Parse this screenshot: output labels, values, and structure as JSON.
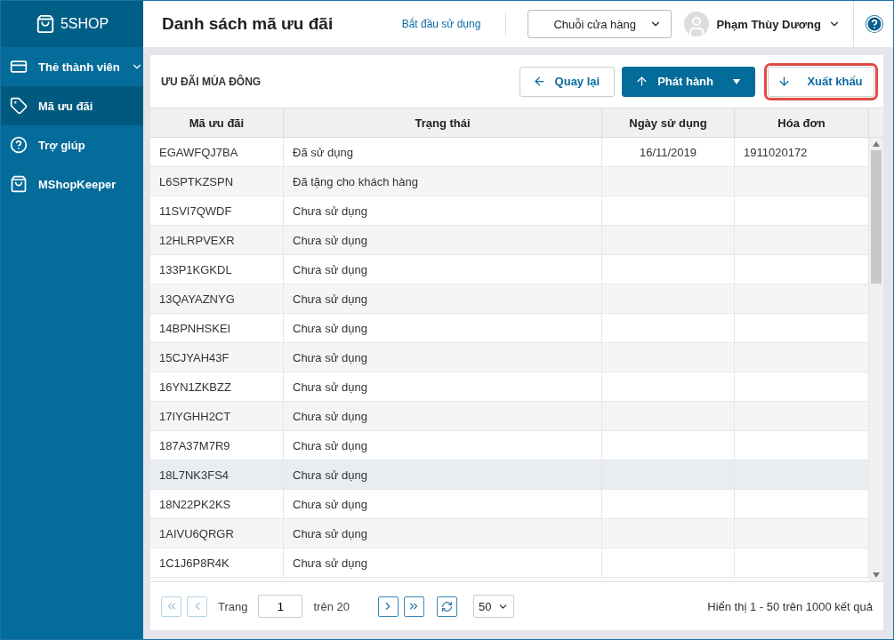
{
  "brand": "5SHOP",
  "sidebar": {
    "items": [
      {
        "label": "Thẻ thành viên",
        "has_caret": true,
        "selected": false
      },
      {
        "label": "Mã ưu đãi",
        "has_caret": false,
        "selected": true
      },
      {
        "label": "Trợ giúp",
        "has_caret": false,
        "selected": false
      },
      {
        "label": "MShopKeeper",
        "has_caret": false,
        "selected": false
      }
    ]
  },
  "header": {
    "title": "Danh sách mã ưu đãi",
    "start_link": "Bắt đầu sử dụng",
    "store_select": "Chuỗi cửa hàng",
    "user_name": "Phạm Thùy Dương"
  },
  "panel": {
    "title": "ƯU ĐÃI MÙA ĐÔNG",
    "buttons": [
      {
        "label": "Quay lại",
        "kind": "back",
        "highlighted": false
      },
      {
        "label": "Phát hành",
        "kind": "issue",
        "highlighted": false
      },
      {
        "label": "Xuất khẩu",
        "kind": "export",
        "highlighted": true
      }
    ]
  },
  "table": {
    "columns": [
      "Mã ưu đãi",
      "Trạng thái",
      "Ngày sử dụng",
      "Hóa đơn"
    ],
    "rows": [
      {
        "code": "EGAWFQJ7BA",
        "status": "Đã sử dụng",
        "date": "16/11/2019",
        "invoice": "1911020172",
        "selected": false
      },
      {
        "code": "L6SPTKZSPN",
        "status": "Đã tặng cho khách hàng",
        "selected": false
      },
      {
        "code": "11SVI7QWDF",
        "status": "Chưa sử dụng",
        "selected": false
      },
      {
        "code": "12HLRPVEXR",
        "status": "Chưa sử dụng",
        "selected": false
      },
      {
        "code": "133P1KGKDL",
        "status": "Chưa sử dụng",
        "selected": false
      },
      {
        "code": "13QAYAZNYG",
        "status": "Chưa sử dụng",
        "selected": false
      },
      {
        "code": "14BPNHSKEI",
        "status": "Chưa sử dụng",
        "selected": false
      },
      {
        "code": "15CJYAH43F",
        "status": "Chưa sử dụng",
        "selected": false
      },
      {
        "code": "16YN1ZKBZZ",
        "status": "Chưa sử dụng",
        "selected": false
      },
      {
        "code": "17IYGHH2CT",
        "status": "Chưa sử dụng",
        "selected": false
      },
      {
        "code": "187A37M7R9",
        "status": "Chưa sử dụng",
        "selected": false
      },
      {
        "code": "18L7NK3FS4",
        "status": "Chưa sử dụng",
        "selected": true
      },
      {
        "code": "18N22PK2KS",
        "status": "Chưa sử dụng",
        "selected": false
      },
      {
        "code": "1AIVU6QRGR",
        "status": "Chưa sử dụng",
        "selected": false
      },
      {
        "code": "1C1J6P8R4K",
        "status": "Chưa sử dụng",
        "selected": false
      }
    ]
  },
  "pagination": {
    "page_label": "Trang",
    "page": "1",
    "of_label": "trên 20",
    "page_size": "50",
    "summary": "Hiển thị 1 - 50 trên 1000 kết quả"
  }
}
